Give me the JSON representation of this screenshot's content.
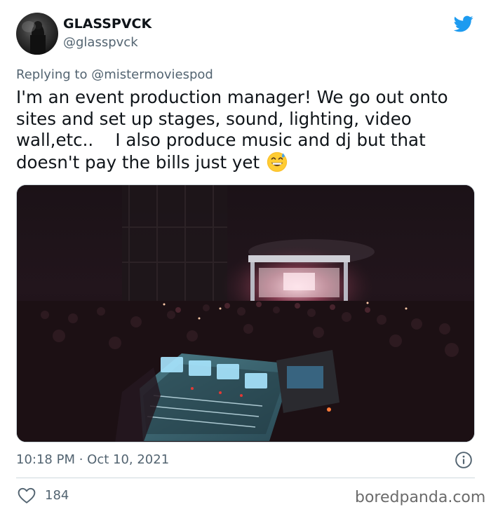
{
  "author": {
    "display_name": "GLASSPVCK",
    "handle": "@glasspvck"
  },
  "reply": {
    "prefix": "Replying to ",
    "mention": "@mistermoviespod"
  },
  "tweet": {
    "text": "I'm an event production manager! We go out onto\nsites and set up stages, sound, lighting, video\nwall,etc..    I also produce music and dj but that\ndoesn't pay the bills just yet ",
    "emoji": "grinning-face-with-sweat",
    "media": "concert-stage-crowd-mixing-console-photo"
  },
  "meta": {
    "timestamp": "10:18 PM · Oct 10, 2021"
  },
  "actions": {
    "like_count": "184"
  },
  "watermark": "boredpanda.com",
  "colors": {
    "twitter_blue": "#1d9bf0",
    "secondary_text": "#536471",
    "border": "#cfd9de"
  }
}
